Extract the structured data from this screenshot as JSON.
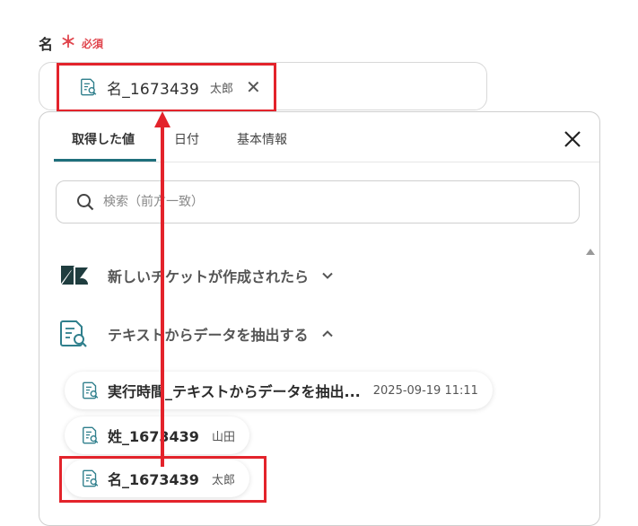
{
  "field": {
    "label": "名",
    "required_mark": "＊",
    "required_text": "必須"
  },
  "selected": {
    "name": "名_1673439",
    "value": "太郎",
    "remove_icon": "close-icon"
  },
  "tabs": [
    {
      "label": "取得した値",
      "active": true
    },
    {
      "label": "日付",
      "active": false
    },
    {
      "label": "基本情報",
      "active": false
    }
  ],
  "search": {
    "placeholder": "検索（前方一致）"
  },
  "sections": [
    {
      "title": "新しいチケットが作成されたら",
      "icon": "zendesk-logo-icon",
      "expanded": false
    },
    {
      "title": "テキストからデータを抽出する",
      "icon": "document-search-icon",
      "expanded": true
    }
  ],
  "items": [
    {
      "name": "実行時間_テキストからデータを抽出...",
      "value": "2025-09-19 11:11"
    },
    {
      "name": "姓_1673439",
      "value": "山田"
    },
    {
      "name": "名_1673439",
      "value": "太郎"
    }
  ],
  "colors": {
    "accent": "#1f6f7c",
    "highlight": "#e3232b",
    "required": "#e0454d"
  }
}
